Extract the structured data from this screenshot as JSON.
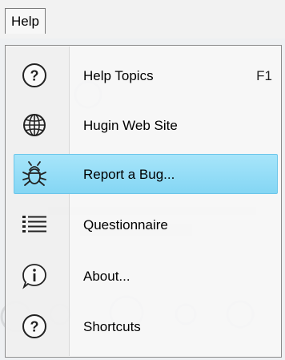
{
  "menubar": {
    "help_label": "Help"
  },
  "menu": {
    "items": [
      {
        "label": "Help Topics",
        "shortcut": "F1",
        "icon": "help-icon"
      },
      {
        "label": "Hugin Web Site",
        "shortcut": "",
        "icon": "globe-icon"
      },
      {
        "label": "Report a Bug...",
        "shortcut": "",
        "icon": "bug-icon",
        "selected": true
      },
      {
        "label": "Questionnaire",
        "shortcut": "",
        "icon": "list-icon"
      },
      {
        "label": "About...",
        "shortcut": "",
        "icon": "info-icon"
      },
      {
        "label": "Shortcuts",
        "shortcut": "",
        "icon": "help-icon"
      }
    ]
  },
  "colors": {
    "selection": "#8fdcf7",
    "selection_border": "#6cc6ea"
  }
}
